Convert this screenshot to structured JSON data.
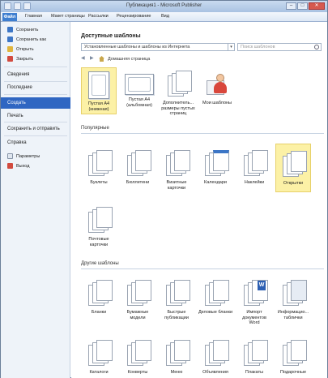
{
  "window": {
    "title": "Публикация1 - Microsoft Publisher",
    "controls": [
      "–",
      "□",
      "✕"
    ]
  },
  "ribbon": {
    "tabs": [
      "Файл",
      "Главная",
      "Макет страницы",
      "Рассылки",
      "Рецензирование",
      "Вид"
    ]
  },
  "sidebar": {
    "commands": [
      {
        "label": "Сохранить",
        "icon": "save-icon"
      },
      {
        "label": "Сохранить как",
        "icon": "save-as-icon"
      },
      {
        "label": "Открыть",
        "icon": "open-folder-icon"
      },
      {
        "label": "Закрыть",
        "icon": "close-document-icon"
      }
    ],
    "nav": {
      "info": "Сведения",
      "recent": "Последние",
      "create": "Создать",
      "print": "Печать",
      "save_send": "Сохранить и отправить",
      "help": "Справка"
    },
    "bottom": [
      {
        "label": "Параметры",
        "icon": "options-icon"
      },
      {
        "label": "Выход",
        "icon": "exit-icon"
      }
    ]
  },
  "main": {
    "heading": "Доступные шаблоны",
    "combo_value": "Установленные шаблоны и шаблоны из Интернета",
    "search_placeholder": "Поиск шаблонов",
    "breadcrumb": "Домашняя страница",
    "top_tiles": [
      {
        "label": "Пустая А4 (книжная)"
      },
      {
        "label": "Пустая А4 (альбомная)"
      },
      {
        "label": "Дополнитель... размеры пустых страниц"
      },
      {
        "label": "Мои шаблоны"
      }
    ],
    "popular_heading": "Популярные",
    "popular": [
      {
        "label": "Буклеты"
      },
      {
        "label": "Бюллетени"
      },
      {
        "label": "Визитные карточки"
      },
      {
        "label": "Календари"
      },
      {
        "label": "Наклейки"
      },
      {
        "label": "Открытки"
      },
      {
        "label": "Почтовые карточки"
      }
    ],
    "other_heading": "Другие шаблоны",
    "other": [
      {
        "label": "Бланки"
      },
      {
        "label": "Бумажные модели"
      },
      {
        "label": "Быстрые публикации"
      },
      {
        "label": "Деловые бланки"
      },
      {
        "label": "Импорт документов Word"
      },
      {
        "label": "Информацио... таблички"
      },
      {
        "label": "Каталоги"
      },
      {
        "label": "Конверты"
      },
      {
        "label": "Меню"
      },
      {
        "label": "Объявления"
      },
      {
        "label": "Плакаты"
      },
      {
        "label": "Подарочные"
      }
    ]
  },
  "colors": {
    "selected_nav": "#2f66c2",
    "selected_tile": "#fcf1a6",
    "file_tab": "#3f7fd0"
  }
}
